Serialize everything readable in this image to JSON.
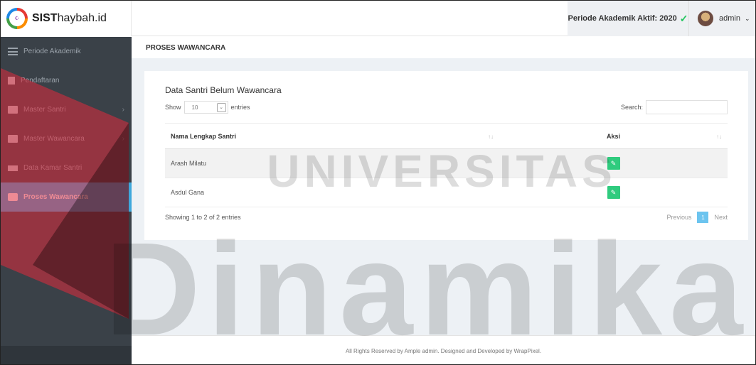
{
  "brand": {
    "bold": "SIST",
    "rest": "haybah.id"
  },
  "topbar": {
    "period_label": "Periode Akademik Aktif: 2020",
    "user_name": "admin"
  },
  "sidebar": {
    "items": [
      {
        "label": "Periode Akademik",
        "icon": "list-icon",
        "chevron": false,
        "active": false
      },
      {
        "label": "Pendaftaran",
        "icon": "document-icon",
        "chevron": false,
        "active": false
      },
      {
        "label": "Master Santri",
        "icon": "id-card-icon",
        "chevron": true,
        "active": false
      },
      {
        "label": "Master Wawancara",
        "icon": "id-card-icon",
        "chevron": true,
        "active": false
      },
      {
        "label": "Data Kamar Santri",
        "icon": "bed-icon",
        "chevron": false,
        "active": false
      },
      {
        "label": "Proses Wawancara",
        "icon": "chat-icon",
        "chevron": false,
        "active": true
      }
    ]
  },
  "page": {
    "title": "PROSES WAWANCARA"
  },
  "card": {
    "title": "Data Santri Belum Wawancara",
    "show_label": "Show",
    "entries_value": "10",
    "entries_label": "entries",
    "search_label": "Search:",
    "search_value": "",
    "columns": [
      "Nama Lengkap Santri",
      "Aksi"
    ],
    "rows": [
      {
        "name": "Arash Milatu"
      },
      {
        "name": "Asdul Gana"
      }
    ],
    "info": "Showing 1 to 2 of 2 entries",
    "pager": {
      "prev": "Previous",
      "current": "1",
      "next": "Next"
    }
  },
  "footer": {
    "text": "All Rights Reserved by Ample admin. Designed and Developed by WrapPixel."
  },
  "watermark": {
    "top": "UNIVERSITAS",
    "bottom": "Dinamika"
  },
  "colors": {
    "sidebar_bg": "#3a4148",
    "active_item": "#3fa8dc",
    "action_button": "#2fcb7e",
    "check": "#22c55e",
    "watermark_red": "#e0293d"
  }
}
